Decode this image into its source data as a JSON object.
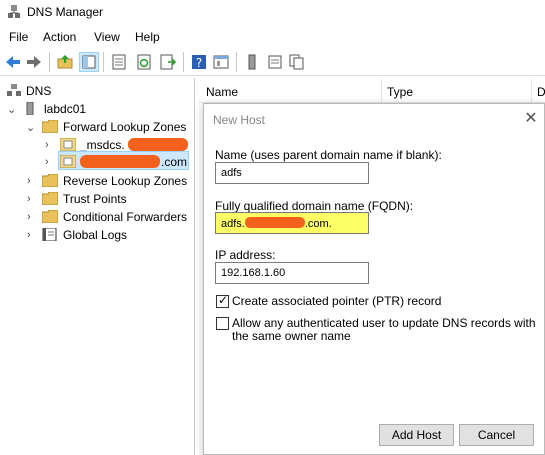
{
  "window": {
    "title": "DNS Manager"
  },
  "menu": [
    "File",
    "Action",
    "View",
    "Help"
  ],
  "toolbar_icons": [
    "back-arrow-icon",
    "forward-arrow-icon",
    "up-folder-icon",
    "show-hide-tree-icon",
    "properties-icon",
    "refresh-icon",
    "export-list-icon",
    "help-icon",
    "console-icon",
    "server-icon",
    "zones-icon",
    "records-icon"
  ],
  "tree": {
    "root": "DNS",
    "server": "labdc01",
    "forward_zones": "Forward Lookup Zones",
    "msdcs_zone": "_msdcs.",
    "domain_zone_suffix": ".com",
    "reverse_zones": "Reverse Lookup Zones",
    "trust_points": "Trust Points",
    "conditional_forwarders": "Conditional Forwarders",
    "global_logs": "Global Logs"
  },
  "list": {
    "col_name": "Name",
    "col_type": "Type",
    "col_data": "D"
  },
  "dialog": {
    "title": "New Host",
    "close": "✕",
    "name_label": "Name (uses parent domain name if blank):",
    "name_value": "adfs",
    "fqdn_label": "Fully qualified domain name (FQDN):",
    "fqdn_prefix": "adfs.",
    "fqdn_suffix": ".com.",
    "ip_label": "IP address:",
    "ip_value": "192.168.1.60",
    "ptr_label": "Create associated pointer (PTR) record",
    "ptr_checked": true,
    "allow_label": "Allow any authenticated user to update DNS records with the same owner name",
    "allow_checked": false,
    "add_host_button": "Add Host",
    "cancel_button": "Cancel"
  },
  "colors": {
    "redaction": "#f4611c",
    "fqdn_highlight": "#ffff66",
    "selection": "#cce8ff"
  }
}
